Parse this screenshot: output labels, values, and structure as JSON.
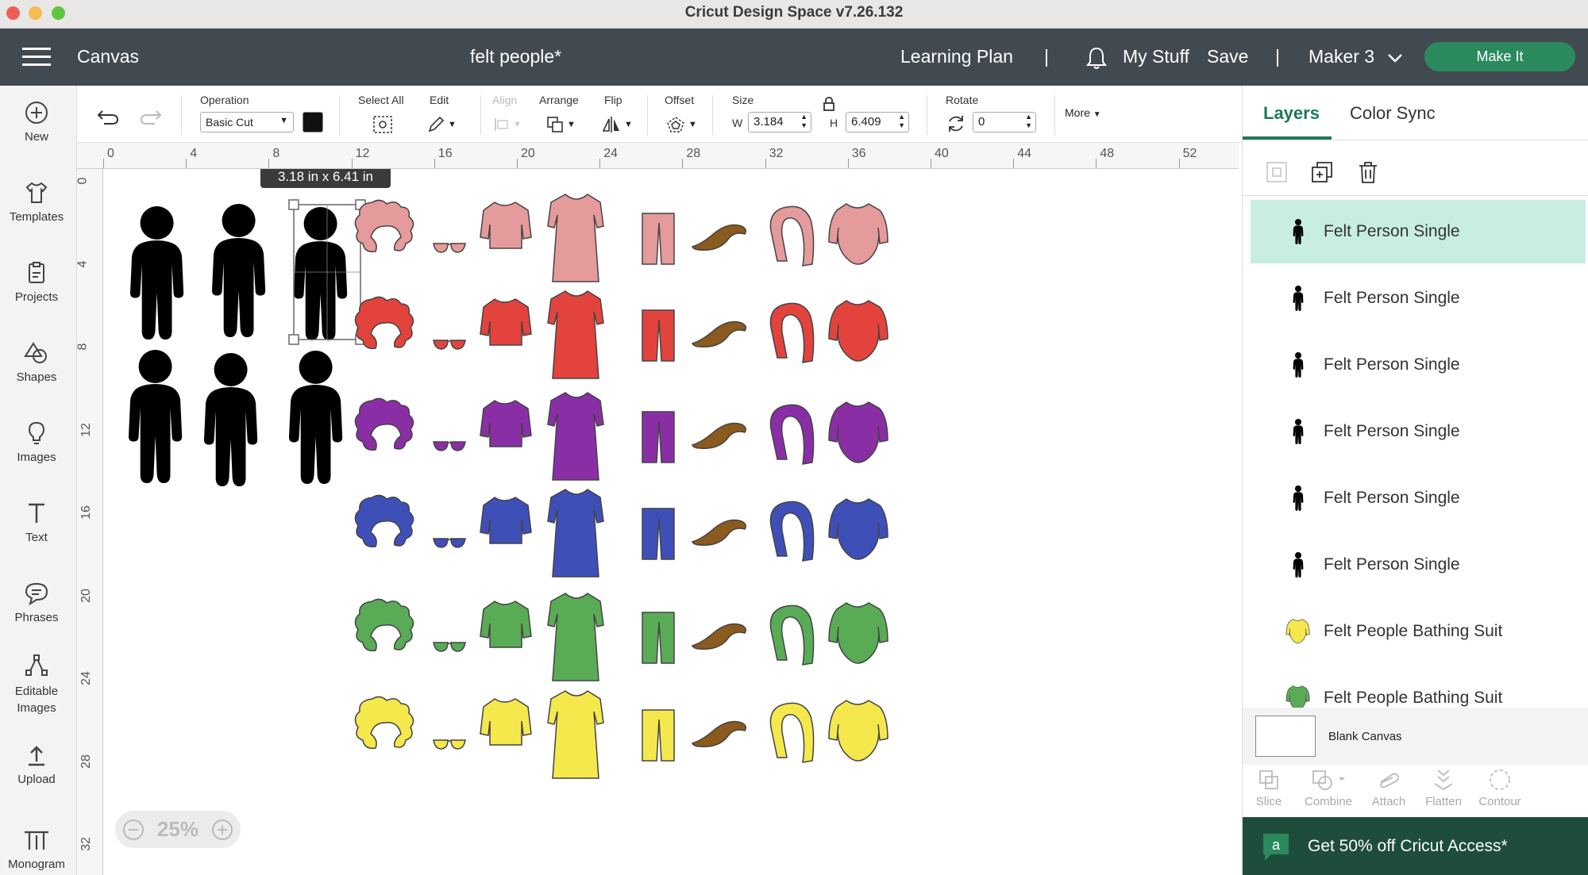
{
  "window": {
    "title": "Cricut Design Space  v7.26.132"
  },
  "topbar": {
    "canvas_label": "Canvas",
    "project_name": "felt people*",
    "learning_plan": "Learning Plan",
    "sep": "|",
    "my_stuff": "My Stuff",
    "save": "Save",
    "machine": "Maker 3",
    "make_it": "Make It"
  },
  "toolbar": {
    "operation_label": "Operation",
    "operation_value": "Basic Cut",
    "select_all": "Select All",
    "edit": "Edit",
    "align": "Align",
    "arrange": "Arrange",
    "flip": "Flip",
    "offset": "Offset",
    "size": "Size",
    "w_label": "W",
    "w_value": "3.184",
    "h_label": "H",
    "h_value": "6.409",
    "rotate": "Rotate",
    "rotate_value": "0",
    "more": "More"
  },
  "left_nav": [
    "New",
    "Templates",
    "Projects",
    "Shapes",
    "Images",
    "Text",
    "Phrases",
    "Editable Images",
    "Upload",
    "Monogram"
  ],
  "ruler_top": [
    "0",
    "4",
    "8",
    "12",
    "16",
    "20",
    "24",
    "28",
    "32",
    "36",
    "40",
    "44",
    "48",
    "52"
  ],
  "ruler_left": [
    "0",
    "4",
    "8",
    "12",
    "16",
    "20",
    "24",
    "28",
    "32"
  ],
  "canvas": {
    "size_tooltip": "3.18  in x 6.41  in",
    "zoom": "25%",
    "clothing_colors": [
      "#e59b9b",
      "#e3433d",
      "#8a2ea6",
      "#3f4fb8",
      "#5aab56",
      "#f5e84d"
    ],
    "mustache_color": "#8b5a1e"
  },
  "right_panel": {
    "tabs": [
      "Layers",
      "Color Sync"
    ],
    "layers": [
      {
        "label": "Felt Person Single",
        "selected": true,
        "icon": "person-icon"
      },
      {
        "label": "Felt Person Single",
        "icon": "person-icon"
      },
      {
        "label": "Felt Person Single",
        "icon": "person-icon"
      },
      {
        "label": "Felt Person Single",
        "icon": "person-icon"
      },
      {
        "label": "Felt Person Single",
        "icon": "person-icon"
      },
      {
        "label": "Felt Person Single",
        "icon": "person-icon"
      },
      {
        "label": "Felt People Bathing Suit",
        "icon": "bathing-suit-icon",
        "color": "#f5e84d"
      },
      {
        "label": "Felt People Bathing Suit",
        "icon": "bathing-suit-icon",
        "color": "#5aab56"
      }
    ],
    "blank_canvas": "Blank Canvas",
    "bottom_tools": [
      "Slice",
      "Combine",
      "Attach",
      "Flatten",
      "Contour"
    ],
    "promo": "Get 50% off Cricut Access*"
  }
}
